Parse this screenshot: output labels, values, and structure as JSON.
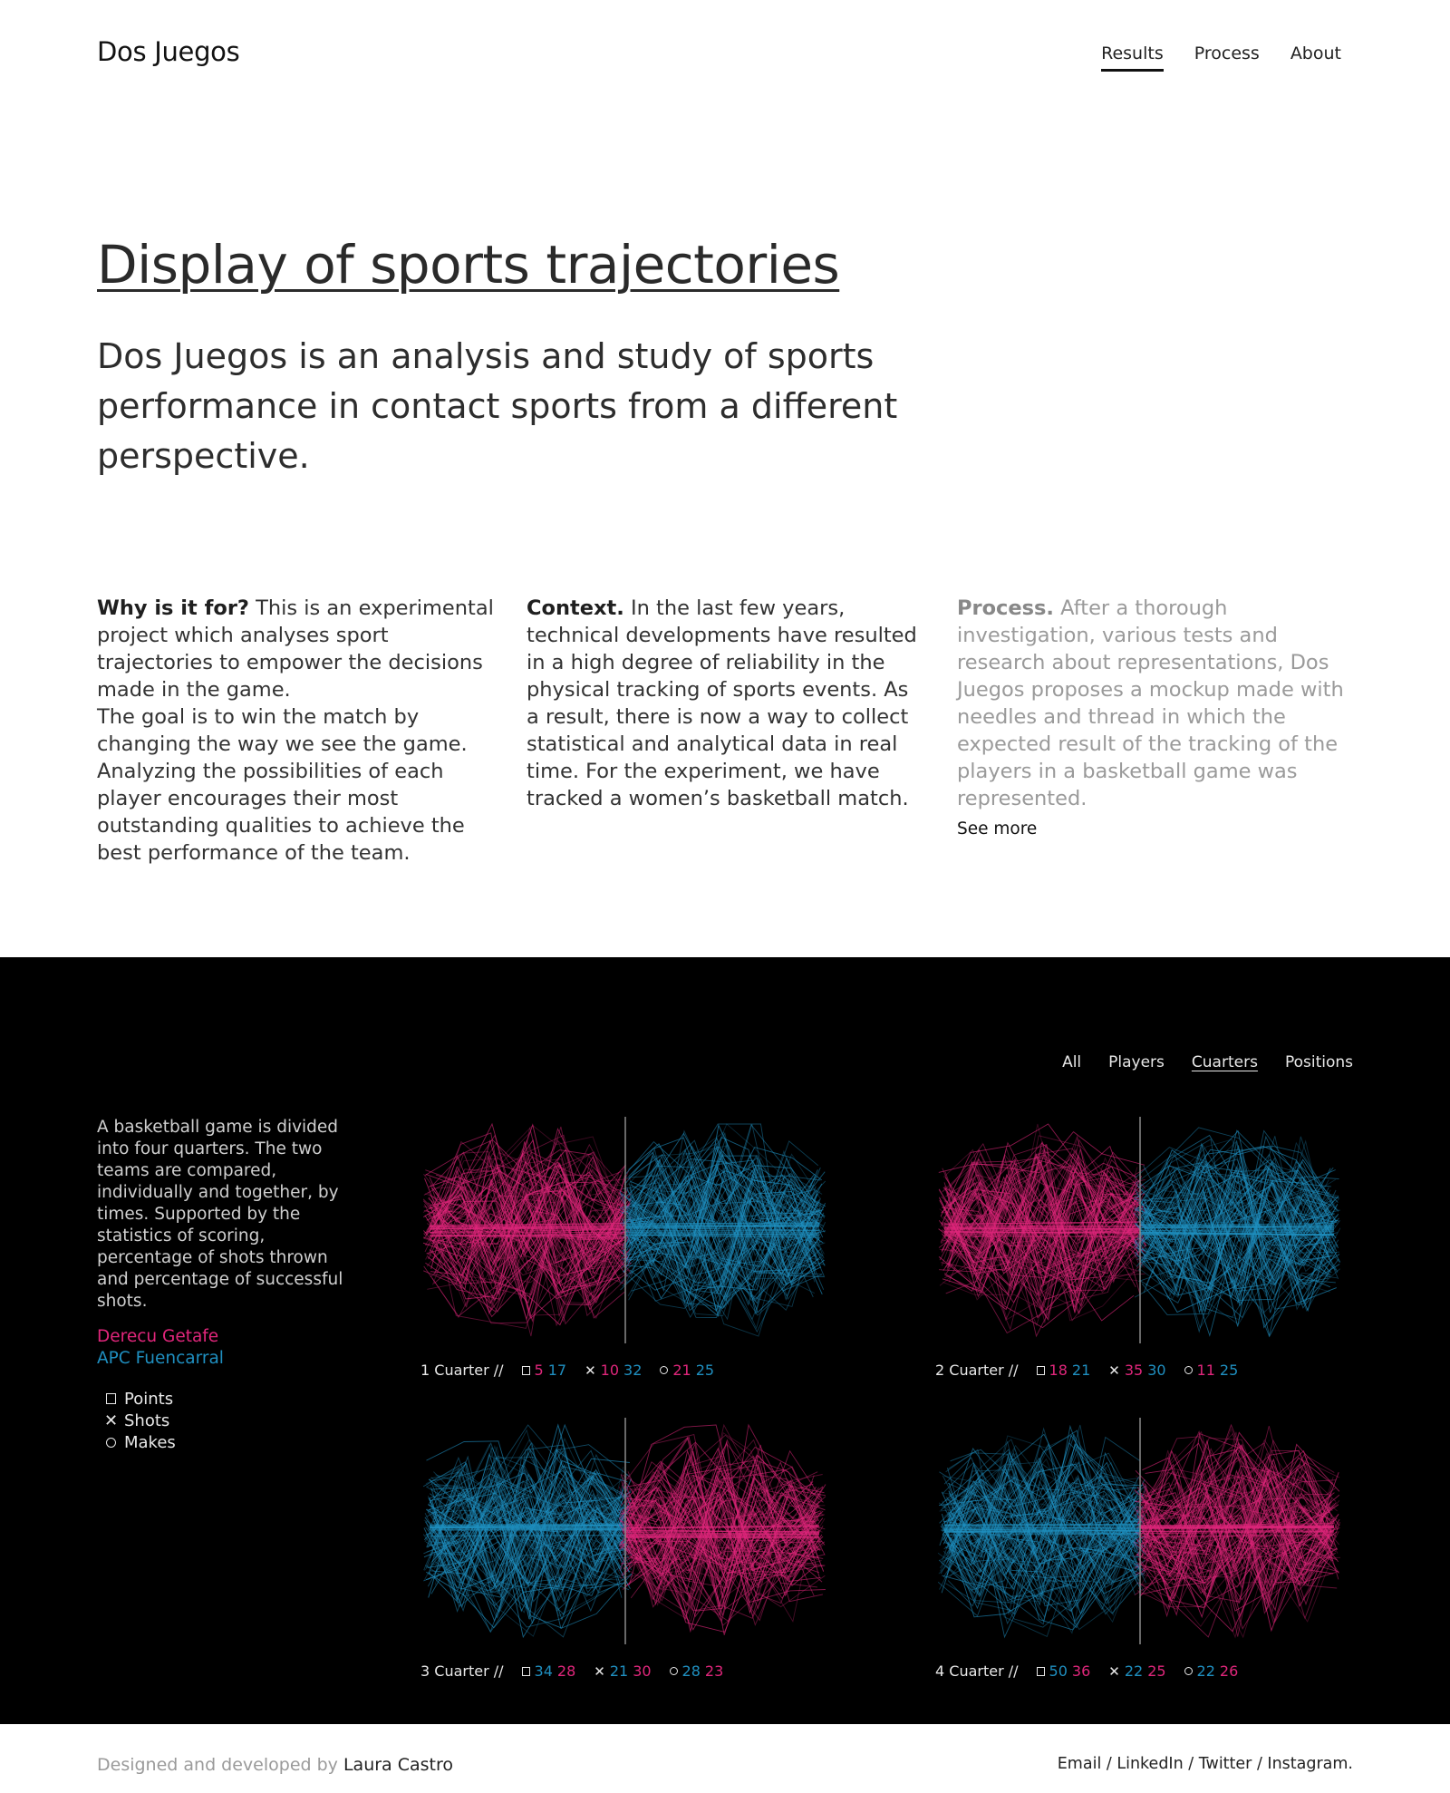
{
  "header": {
    "brand": "Dos Juegos",
    "nav": [
      {
        "label": "Results",
        "active": true
      },
      {
        "label": "Process",
        "active": false
      },
      {
        "label": "About",
        "active": false
      }
    ]
  },
  "hero": {
    "title": "Display of sports trajectories",
    "subtitle": "Dos Juegos is an analysis and study of sports performance in contact sports from a different perspective."
  },
  "columns": {
    "why": {
      "heading": "Why is it for?",
      "text": " This is an experimental project which analyses sport trajectories to empower the decisions made in the game.",
      "text2": "The goal is to win the match by changing the way we see the game. Analyzing the possibilities of each player encourages their most outstanding qualities to achieve the best performance of the team."
    },
    "context": {
      "heading": "Context.",
      "text": " In the last few years, technical developments have resulted in a high degree of reliability in the physical tracking of sports events. As a result, there is now a way to collect statistical and analytical data in real time. For the experiment, we have tracked a women’s basketball match."
    },
    "process": {
      "heading": "Process.",
      "text": " After a thorough investigation, various tests and research about representations, Dos Juegos proposes a mockup made with needles and thread in which the expected result of the tracking of the players in a basketball game was represented.",
      "see_more": "See more"
    }
  },
  "viz": {
    "filters": [
      {
        "label": "All",
        "active": false
      },
      {
        "label": "Players",
        "active": false
      },
      {
        "label": "Cuarters",
        "active": true
      },
      {
        "label": "Positions",
        "active": false
      }
    ],
    "description": "A basketball game is divided into four quarters. The two teams are compared, individually and together, by times. Supported by the statistics of scoring, percentage of shots thrown and percentage of successful shots.",
    "teams": [
      {
        "name": "Derecu Getafe",
        "color": "#e0267b"
      },
      {
        "name": "APC Fuencarral",
        "color": "#1f8fc0"
      }
    ],
    "legend": [
      {
        "symbol": "square-icon",
        "label": "Points"
      },
      {
        "symbol": "cross-icon",
        "label": "Shots"
      },
      {
        "symbol": "circle-icon",
        "label": "Makes"
      }
    ],
    "quarters": [
      {
        "name": "1 Cuarter //",
        "left_team": "pink",
        "points": [
          "5",
          "17"
        ],
        "shots": [
          "10",
          "32"
        ],
        "makes": [
          "21",
          "25"
        ],
        "points_colors": [
          "pink",
          "blue"
        ],
        "shots_colors": [
          "pink",
          "blue"
        ],
        "makes_colors": [
          "pink",
          "blue"
        ]
      },
      {
        "name": "2 Cuarter //",
        "left_team": "pink",
        "points": [
          "18",
          "21"
        ],
        "shots": [
          "35",
          "30"
        ],
        "makes": [
          "11",
          "25"
        ],
        "points_colors": [
          "pink",
          "blue"
        ],
        "shots_colors": [
          "pink",
          "blue"
        ],
        "makes_colors": [
          "pink",
          "blue"
        ]
      },
      {
        "name": "3 Cuarter //",
        "left_team": "blue",
        "points": [
          "34",
          "28"
        ],
        "shots": [
          "21",
          "30"
        ],
        "makes": [
          "28",
          "23"
        ],
        "points_colors": [
          "blue",
          "pink"
        ],
        "shots_colors": [
          "blue",
          "pink"
        ],
        "makes_colors": [
          "blue",
          "pink"
        ]
      },
      {
        "name": "4 Cuarter //",
        "left_team": "blue",
        "points": [
          "50",
          "36"
        ],
        "shots": [
          "22",
          "25"
        ],
        "makes": [
          "22",
          "26"
        ],
        "points_colors": [
          "blue",
          "pink"
        ],
        "shots_colors": [
          "blue",
          "pink"
        ],
        "makes_colors": [
          "blue",
          "pink"
        ]
      }
    ],
    "colors": {
      "pink": "#e0267b",
      "blue": "#1f8fc0"
    }
  },
  "footer": {
    "credit_prefix": "Designed and developed by ",
    "credit_name": "Laura Castro",
    "links": [
      "Email",
      "LinkedIn",
      "Twitter",
      "Instagram."
    ],
    "separator": " / "
  }
}
